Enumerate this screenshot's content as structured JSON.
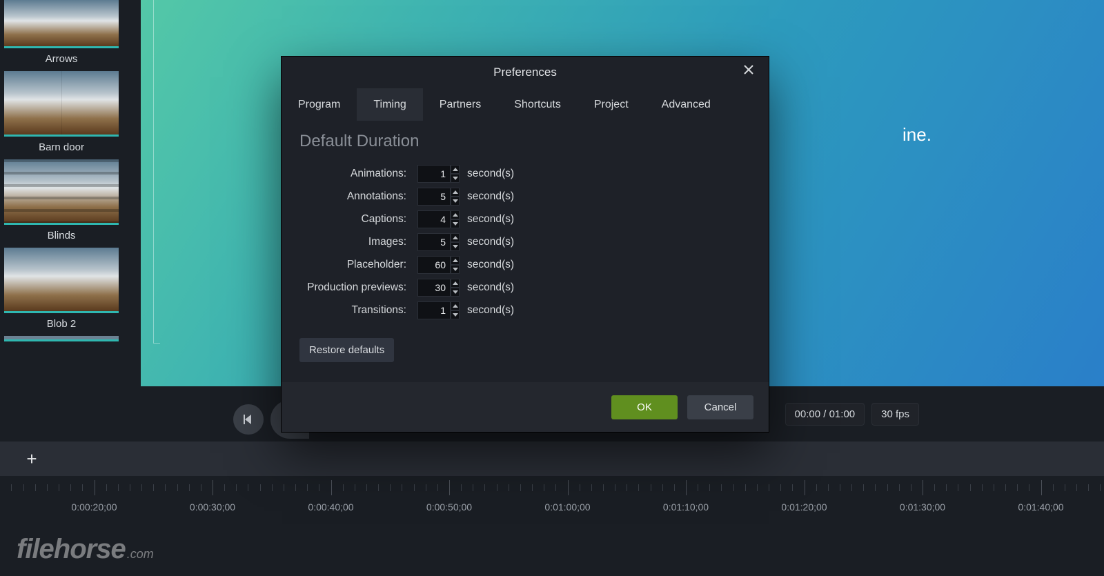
{
  "sidebar": {
    "items": [
      {
        "label": "Arrows"
      },
      {
        "label": "Barn door"
      },
      {
        "label": "Blinds"
      },
      {
        "label": "Blob 2"
      }
    ]
  },
  "preview": {
    "trailing_text": "ine."
  },
  "controls": {
    "time": "00:00 / 01:00",
    "fps": "30 fps"
  },
  "ruler": {
    "labels": [
      "0:00:20;00",
      "0:00:30;00",
      "0:00:40;00",
      "0:00:50;00",
      "0:01:00;00",
      "0:01:10;00",
      "0:01:20;00",
      "0:01:30;00",
      "0:01:40;00"
    ]
  },
  "dialog": {
    "title": "Preferences",
    "tabs": [
      "Program",
      "Timing",
      "Partners",
      "Shortcuts",
      "Project",
      "Advanced"
    ],
    "active_tab": 1,
    "section": "Default Duration",
    "unit": "second(s)",
    "fields": [
      {
        "label": "Animations:",
        "value": "1"
      },
      {
        "label": "Annotations:",
        "value": "5"
      },
      {
        "label": "Captions:",
        "value": "4"
      },
      {
        "label": "Images:",
        "value": "5"
      },
      {
        "label": "Placeholder:",
        "value": "60"
      },
      {
        "label": "Production previews:",
        "value": "30"
      },
      {
        "label": "Transitions:",
        "value": "1"
      }
    ],
    "restore": "Restore defaults",
    "ok": "OK",
    "cancel": "Cancel"
  },
  "watermark": {
    "main": "filehorse",
    "suffix": ".com"
  }
}
